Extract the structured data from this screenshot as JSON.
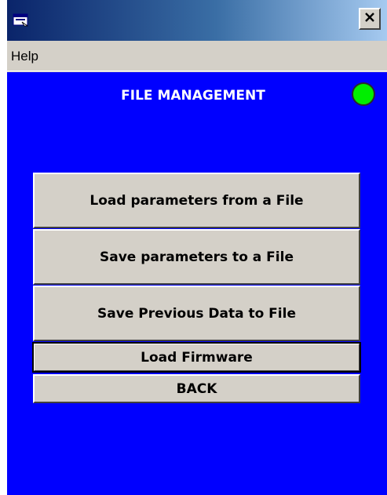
{
  "window": {
    "icon": "application-window-icon",
    "close_label": "×"
  },
  "menu": {
    "items": [
      {
        "label": "Help"
      }
    ]
  },
  "screen": {
    "title": "FILE MANAGEMENT",
    "status_indicator": {
      "state": "ok",
      "color": "#00ee00"
    }
  },
  "buttons": {
    "load_params": "Load parameters from a File",
    "save_params": "Save parameters to a File",
    "save_previous": "Save Previous Data to File",
    "load_firmware": "Load Firmware",
    "back": "BACK"
  },
  "colors": {
    "client_background": "#0000ff",
    "face": "#d4d0c8"
  }
}
